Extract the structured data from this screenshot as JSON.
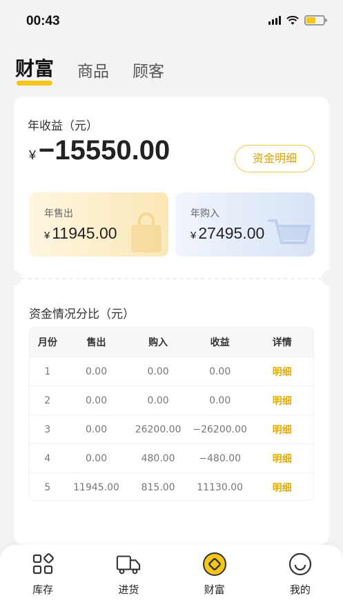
{
  "status": {
    "time": "00:43"
  },
  "tabs": [
    {
      "label": "财富",
      "active": true
    },
    {
      "label": "商品",
      "active": false
    },
    {
      "label": "顾客",
      "active": false
    }
  ],
  "summary": {
    "profit_label": "年收益（元）",
    "currency": "¥",
    "profit_value": "−15550.00",
    "detail_button": "资金明细",
    "sold_label": "年售出",
    "sold_value": "11945.00",
    "bought_label": "年购入",
    "bought_value": "27495.00"
  },
  "breakdown": {
    "title": "资金情况分比（元）",
    "columns": [
      "月份",
      "售出",
      "购入",
      "收益",
      "详情"
    ],
    "rows": [
      [
        "1",
        "0.00",
        "0.00",
        "0.00",
        "明细"
      ],
      [
        "2",
        "0.00",
        "0.00",
        "0.00",
        "明细"
      ],
      [
        "3",
        "0.00",
        "26200.00",
        "−26200.00",
        "明细"
      ],
      [
        "4",
        "0.00",
        "480.00",
        "−480.00",
        "明细"
      ],
      [
        "5",
        "11945.00",
        "815.00",
        "11130.00",
        "明细"
      ]
    ]
  },
  "nav": [
    {
      "label": "库存",
      "icon": "grid-icon"
    },
    {
      "label": "进货",
      "icon": "truck-icon"
    },
    {
      "label": "财富",
      "icon": "wealth-coin-icon",
      "active": true
    },
    {
      "label": "我的",
      "icon": "smile-icon"
    }
  ],
  "colors": {
    "accent": "#f5c518",
    "link": "#e2ad00",
    "background": "#f3f3f5"
  }
}
